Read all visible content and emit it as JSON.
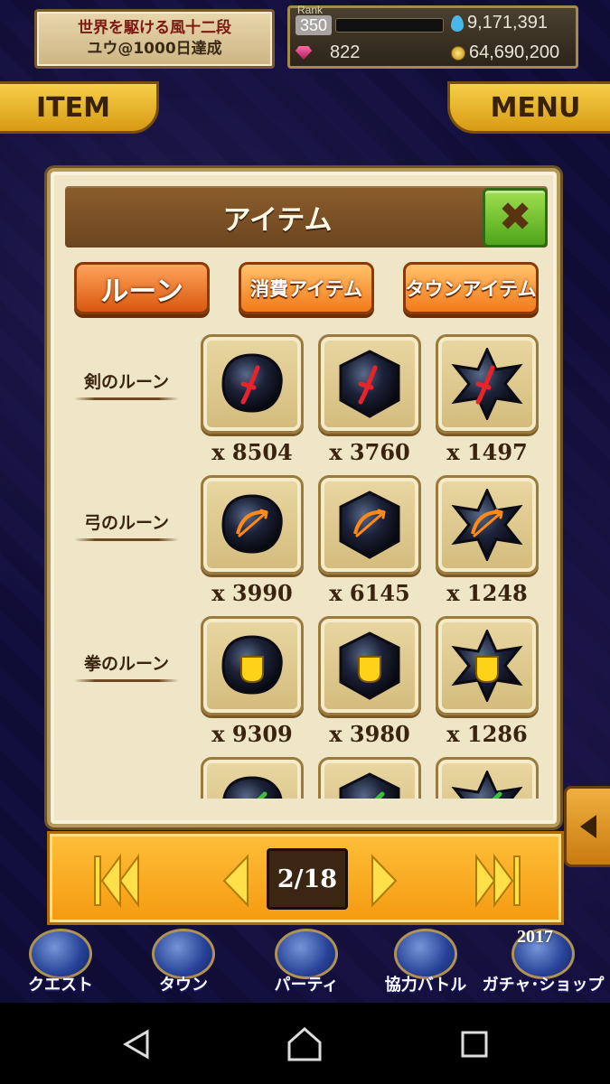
{
  "profile": {
    "title_line1": "世界を駆ける風十二段",
    "title_line2": "ユウ@1000日達成"
  },
  "stats": {
    "rank_label": "Rank",
    "rank": "350",
    "water": "9,171,391",
    "gems": "822",
    "coins": "64,690,200"
  },
  "top_buttons": {
    "item": "ITEM",
    "menu": "MENU"
  },
  "dialog": {
    "title": "アイテム",
    "tabs": [
      {
        "label": "ルーン",
        "selected": true
      },
      {
        "label": "消費アイテム",
        "selected": false
      },
      {
        "label": "タウンアイテム",
        "selected": false
      }
    ],
    "rows": [
      {
        "label": "剣のルーン",
        "emblem": "sword",
        "quantities": [
          "x 8504",
          "x 3760",
          "x 1497"
        ]
      },
      {
        "label": "弓のルーン",
        "emblem": "bow",
        "quantities": [
          "x 3990",
          "x 6145",
          "x 1248"
        ]
      },
      {
        "label": "拳のルーン",
        "emblem": "fist",
        "quantities": [
          "x 9309",
          "x 3980",
          "x 1286"
        ]
      },
      {
        "label": "",
        "emblem": "spear",
        "quantities": [
          "",
          "",
          ""
        ]
      }
    ]
  },
  "pager": {
    "page": "2/18"
  },
  "bottom_nav": [
    {
      "label": "クエスト"
    },
    {
      "label": "タウン"
    },
    {
      "label": "パーティ"
    },
    {
      "label": "協力バトル"
    },
    {
      "label": "ガチャ･ショップ"
    }
  ],
  "bottom_badge": "2017",
  "colors": {
    "accent_orange": "#f49a10",
    "close_green": "#4fa51a",
    "header_brown": "#6c4520",
    "panel_cream": "#efe6c8"
  },
  "icons": {
    "rune_shapes": [
      "blob",
      "hexagon",
      "star"
    ],
    "emblems": {
      "sword": "#e8242a",
      "bow": "#ff8a1a",
      "fist": "#ffd21a",
      "spear": "#3fbf3a"
    }
  }
}
